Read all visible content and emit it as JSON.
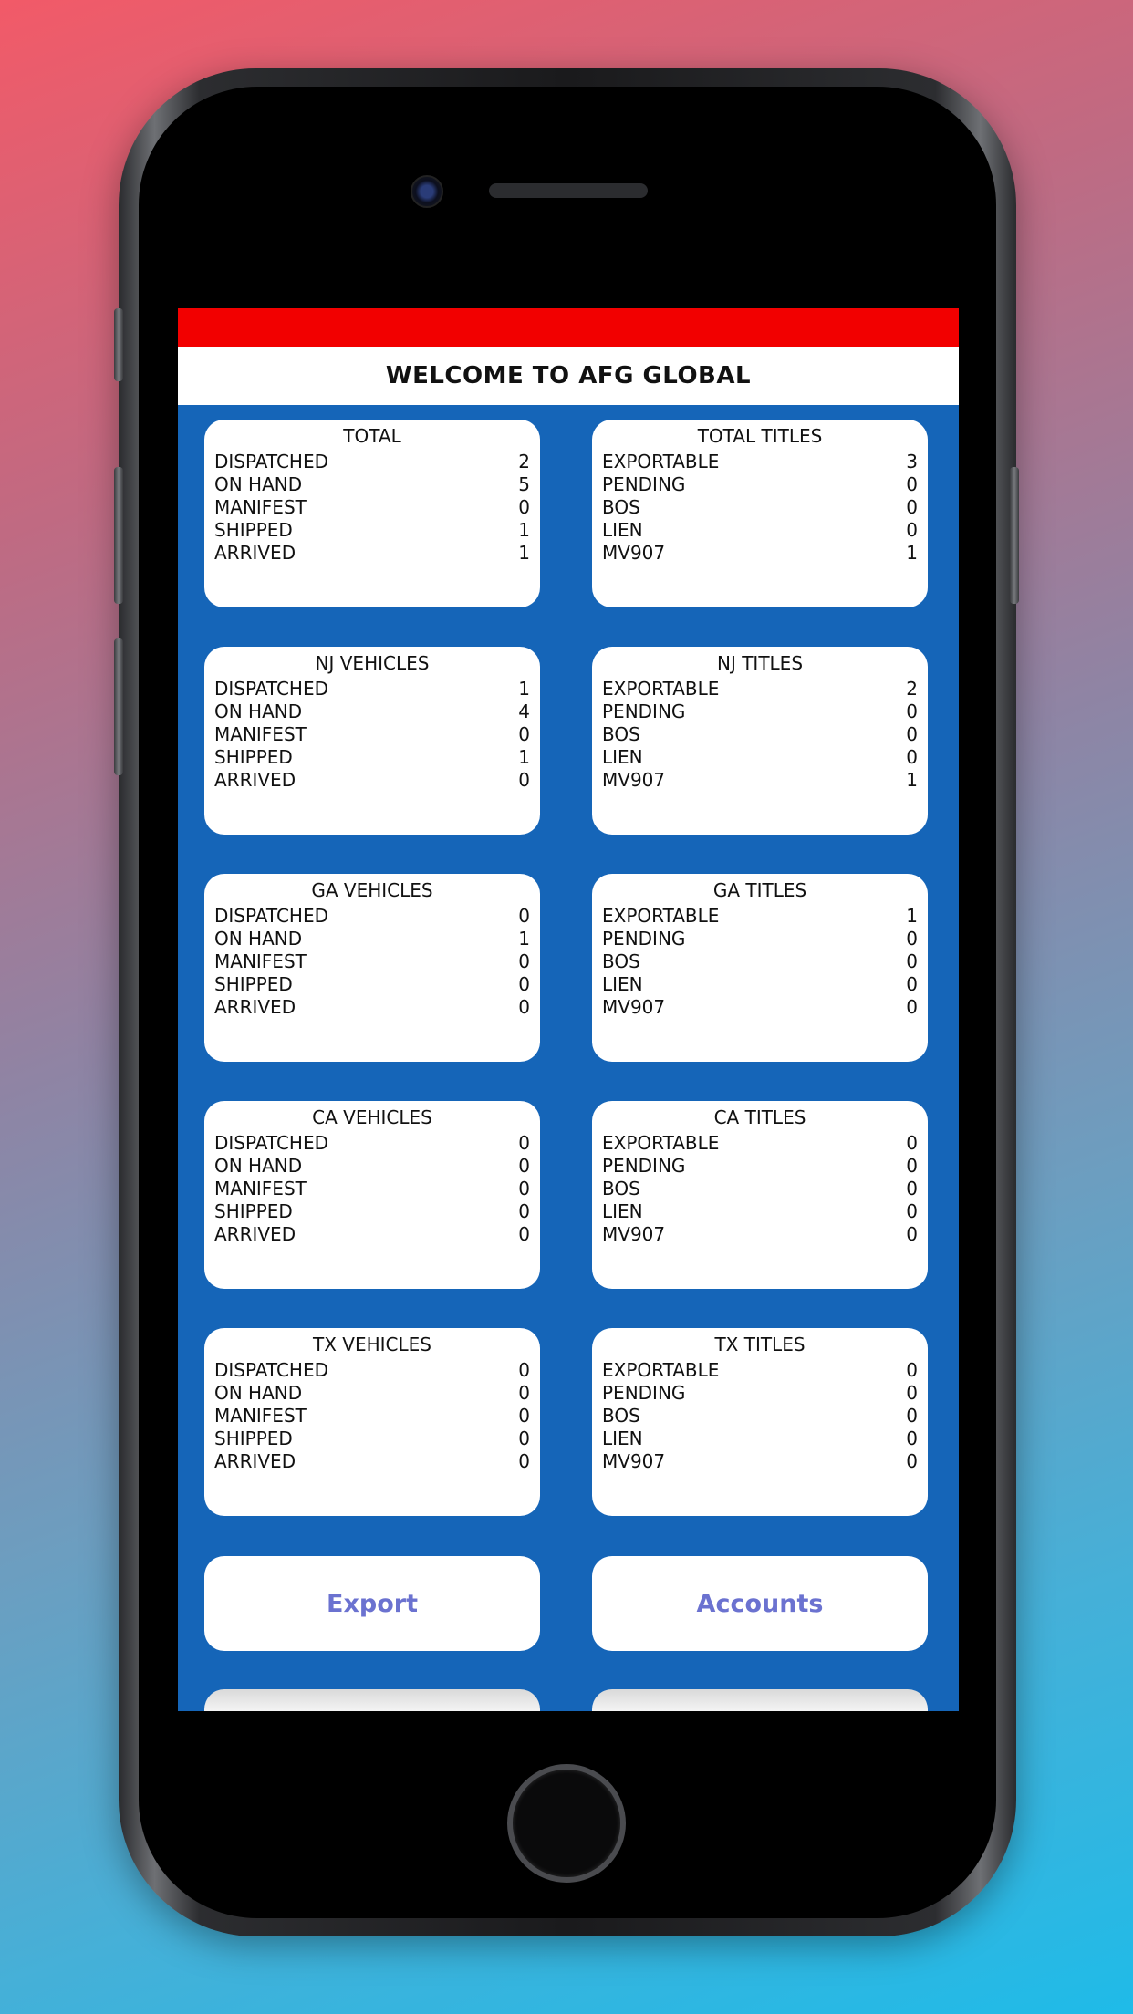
{
  "header": {
    "welcome_text": "WELCOME TO AFG GLOBAL"
  },
  "cards": [
    {
      "title": "TOTAL",
      "rows": [
        {
          "label": "DISPATCHED",
          "value": "2"
        },
        {
          "label": "ON HAND",
          "value": "5"
        },
        {
          "label": "MANIFEST",
          "value": "0"
        },
        {
          "label": "SHIPPED",
          "value": "1"
        },
        {
          "label": "ARRIVED",
          "value": "1"
        }
      ]
    },
    {
      "title": "TOTAL TITLES",
      "rows": [
        {
          "label": "EXPORTABLE",
          "value": "3"
        },
        {
          "label": "PENDING",
          "value": "0"
        },
        {
          "label": "BOS",
          "value": "0"
        },
        {
          "label": "LIEN",
          "value": "0"
        },
        {
          "label": "MV907",
          "value": "1"
        }
      ]
    },
    {
      "title": "NJ VEHICLES",
      "rows": [
        {
          "label": "DISPATCHED",
          "value": "1"
        },
        {
          "label": "ON HAND",
          "value": "4"
        },
        {
          "label": "MANIFEST",
          "value": "0"
        },
        {
          "label": "SHIPPED",
          "value": "1"
        },
        {
          "label": "ARRIVED",
          "value": "0"
        }
      ]
    },
    {
      "title": "NJ TITLES",
      "rows": [
        {
          "label": "EXPORTABLE",
          "value": "2"
        },
        {
          "label": "PENDING",
          "value": "0"
        },
        {
          "label": "BOS",
          "value": "0"
        },
        {
          "label": "LIEN",
          "value": "0"
        },
        {
          "label": "MV907",
          "value": "1"
        }
      ]
    },
    {
      "title": "GA VEHICLES",
      "rows": [
        {
          "label": "DISPATCHED",
          "value": "0"
        },
        {
          "label": "ON HAND",
          "value": "1"
        },
        {
          "label": "MANIFEST",
          "value": "0"
        },
        {
          "label": "SHIPPED",
          "value": "0"
        },
        {
          "label": "ARRIVED",
          "value": "0"
        }
      ]
    },
    {
      "title": "GA TITLES",
      "rows": [
        {
          "label": "EXPORTABLE",
          "value": "1"
        },
        {
          "label": "PENDING",
          "value": "0"
        },
        {
          "label": "BOS",
          "value": "0"
        },
        {
          "label": "LIEN",
          "value": "0"
        },
        {
          "label": "MV907",
          "value": "0"
        }
      ]
    },
    {
      "title": "CA VEHICLES",
      "rows": [
        {
          "label": "DISPATCHED",
          "value": "0"
        },
        {
          "label": "ON HAND",
          "value": "0"
        },
        {
          "label": "MANIFEST",
          "value": "0"
        },
        {
          "label": "SHIPPED",
          "value": "0"
        },
        {
          "label": "ARRIVED",
          "value": "0"
        }
      ]
    },
    {
      "title": "CA TITLES",
      "rows": [
        {
          "label": "EXPORTABLE",
          "value": "0"
        },
        {
          "label": "PENDING",
          "value": "0"
        },
        {
          "label": "BOS",
          "value": "0"
        },
        {
          "label": "LIEN",
          "value": "0"
        },
        {
          "label": "MV907",
          "value": "0"
        }
      ]
    },
    {
      "title": "TX VEHICLES",
      "rows": [
        {
          "label": "DISPATCHED",
          "value": "0"
        },
        {
          "label": "ON HAND",
          "value": "0"
        },
        {
          "label": "MANIFEST",
          "value": "0"
        },
        {
          "label": "SHIPPED",
          "value": "0"
        },
        {
          "label": "ARRIVED",
          "value": "0"
        }
      ]
    },
    {
      "title": "TX TITLES",
      "rows": [
        {
          "label": "EXPORTABLE",
          "value": "0"
        },
        {
          "label": "PENDING",
          "value": "0"
        },
        {
          "label": "BOS",
          "value": "0"
        },
        {
          "label": "LIEN",
          "value": "0"
        },
        {
          "label": "MV907",
          "value": "0"
        }
      ]
    }
  ],
  "buttons": {
    "export_label": "Export",
    "accounts_label": "Accounts"
  },
  "colors": {
    "header_bar": "#f20000",
    "screen_background": "#1565b8",
    "button_text": "#6b72d0"
  }
}
